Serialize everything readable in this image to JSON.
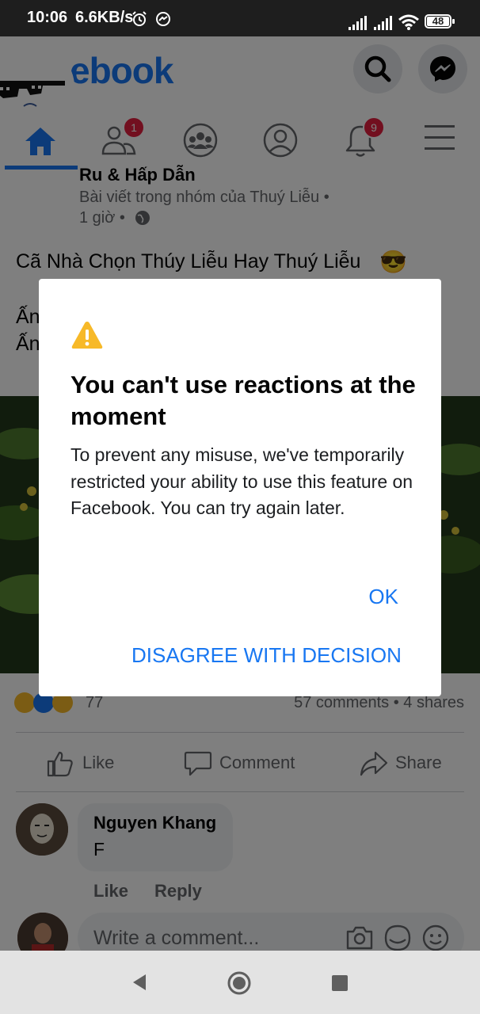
{
  "status_bar": {
    "time": "10:06",
    "speed": "6.6KB/s",
    "battery": "48",
    "icons": [
      "alarm-icon",
      "messenger-status-icon",
      "signal-icon",
      "signal-icon",
      "wifi-icon",
      "battery-icon"
    ]
  },
  "header": {
    "logo_text": "ebook",
    "brand_color": "#1877f2",
    "tabs": [
      {
        "name": "home",
        "icon": "home-icon",
        "active": true
      },
      {
        "name": "friends",
        "icon": "friends-icon",
        "badge": "1"
      },
      {
        "name": "groups",
        "icon": "groups-icon"
      },
      {
        "name": "profile",
        "icon": "profile-icon"
      },
      {
        "name": "notifications",
        "icon": "bell-icon",
        "badge": "9"
      },
      {
        "name": "menu",
        "icon": "menu-icon"
      }
    ]
  },
  "post": {
    "group_name_partial": "Ru & Hấp Dẫn",
    "subtitle": "Bài viết trong nhóm của Thuý Liễu •",
    "time": "1 giờ •",
    "text": "Cã Nhà Chọn Thúy Liễu Hay Thuý Liễu",
    "line2_partial": "Ấn",
    "line3_partial": "Ấn",
    "reaction_count": "77",
    "comments_shares": "57 comments • 4 shares",
    "actions": {
      "like": "Like",
      "comment": "Comment",
      "share": "Share"
    }
  },
  "comment": {
    "author": "Nguyen Khang",
    "text": "F",
    "like": "Like",
    "reply": "Reply",
    "write_placeholder": "Write a comment..."
  },
  "dialog": {
    "title": "You can't use reactions at the moment",
    "body": "To prevent any misuse, we've temporarily restricted your ability to use this feature on Facebook. You can try again later.",
    "ok_label": "OK",
    "disagree_label": "DISAGREE WITH DECISION",
    "warning_color": "#f7b928"
  },
  "nav_bar": {
    "icons": [
      "back-icon",
      "home-nav-icon",
      "recents-icon"
    ]
  }
}
